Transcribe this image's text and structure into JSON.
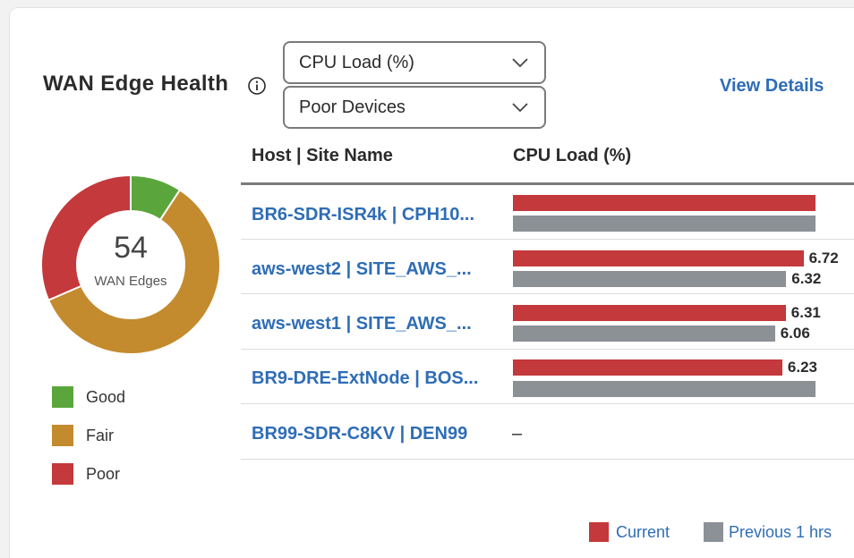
{
  "widget": {
    "title": "WAN Edge Health",
    "view_details": "View Details",
    "metric_select": "CPU Load (%)",
    "filter_select": "Poor Devices"
  },
  "colors": {
    "good": "#5aa63c",
    "fair": "#c48a2e",
    "poor": "#c4393b",
    "current": "#c4393b",
    "previous": "#8c9196",
    "link": "#2f6db5"
  },
  "donut": {
    "total": "54",
    "label": "WAN Edges",
    "segments": [
      {
        "name": "Good",
        "value": 5
      },
      {
        "name": "Fair",
        "value": 32
      },
      {
        "name": "Poor",
        "value": 17
      }
    ]
  },
  "legend": [
    {
      "label": "Good"
    },
    {
      "label": "Fair"
    },
    {
      "label": "Poor"
    }
  ],
  "table": {
    "columns": [
      "Host | Site Name",
      "CPU Load (%)"
    ],
    "rows": [
      {
        "host": "BR6-SDR-ISR4k | CPH10...",
        "current": 7.0,
        "previous": 7.0,
        "current_label": "",
        "previous_label": ""
      },
      {
        "host": "aws-west2 | SITE_AWS_...",
        "current": 6.72,
        "previous": 6.32,
        "current_label": "6.72",
        "previous_label": "6.32"
      },
      {
        "host": "aws-west1 | SITE_AWS_...",
        "current": 6.31,
        "previous": 6.06,
        "current_label": "6.31",
        "previous_label": "6.06"
      },
      {
        "host": "BR9-DRE-ExtNode | BOS...",
        "current": 6.23,
        "previous": 7.0,
        "current_label": "6.23",
        "previous_label": ""
      },
      {
        "host": "BR99-SDR-C8KV | DEN99",
        "current": null,
        "previous": null,
        "empty": "–"
      }
    ]
  },
  "footer_legend": {
    "current": "Current",
    "previous": "Previous 1 hrs"
  }
}
